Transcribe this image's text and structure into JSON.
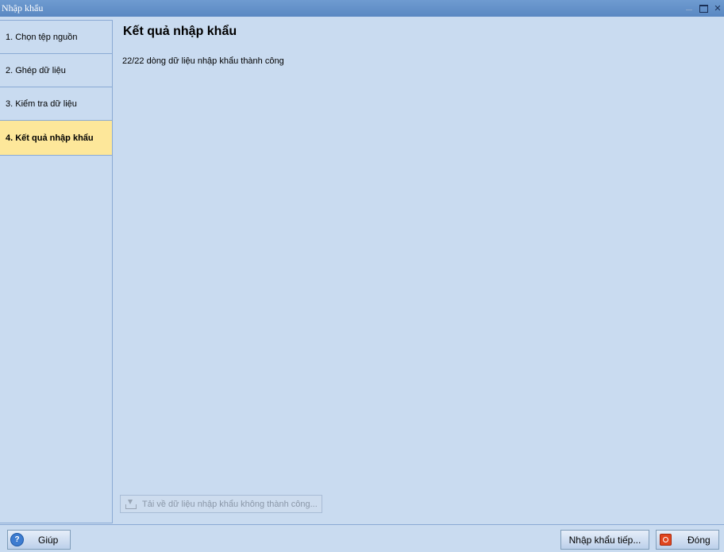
{
  "window": {
    "title": "Nhập khẩu",
    "controls": [
      "minimize-icon",
      "maximize-icon",
      "close-icon"
    ]
  },
  "steps": [
    {
      "label": "1. Chọn tệp nguồn",
      "active": false
    },
    {
      "label": "2. Ghép dữ liệu",
      "active": false
    },
    {
      "label": "3. Kiểm tra dữ liệu",
      "active": false
    },
    {
      "label": "4. Kết quả nhập khẩu",
      "active": true
    }
  ],
  "main": {
    "title": "Kết quả nhập khẩu",
    "message": "22/22 dòng dữ liệu nhập khẩu thành công",
    "download_button": {
      "label": "Tải về dữ liệu nhập khẩu không thành công...",
      "icon": "download-icon",
      "enabled": false
    }
  },
  "footer": {
    "help_label": "Giúp",
    "next_label": "Nhập khẩu tiếp...",
    "close_label": "Đóng"
  },
  "colors": {
    "titlebar": "#5a88c2",
    "background": "#c9dbf0",
    "active_step": "#fde79a",
    "border": "#8aaad4"
  }
}
